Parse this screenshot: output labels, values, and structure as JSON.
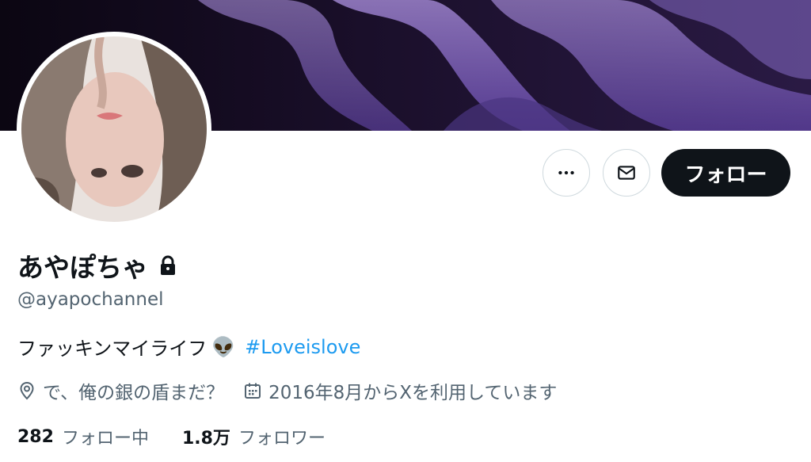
{
  "profile": {
    "display_name": "あやぽちゃ",
    "handle": "@ayapochannel",
    "bio_text": "ファッキンマイライフ",
    "bio_emoji": "👽",
    "hashtag": "#Loveislove",
    "location": "で、俺の銀の盾まだ？",
    "joined": "2016年8月からXを利用しています"
  },
  "stats": {
    "following_count": "282",
    "following_label": "フォロー中",
    "followers_count": "1.8万",
    "followers_label": "フォロワー"
  },
  "actions": {
    "more_icon": "more-horizontal-icon",
    "message_icon": "mail-icon",
    "follow_label": "フォロー"
  },
  "icons": {
    "protected": "lock-icon",
    "location": "location-pin-icon",
    "joined": "calendar-icon"
  },
  "colors": {
    "text_primary": "#0f1419",
    "text_secondary": "#536471",
    "link": "#1d9bf0",
    "follow_button_bg": "#0f1419",
    "border": "#cfd9de"
  }
}
